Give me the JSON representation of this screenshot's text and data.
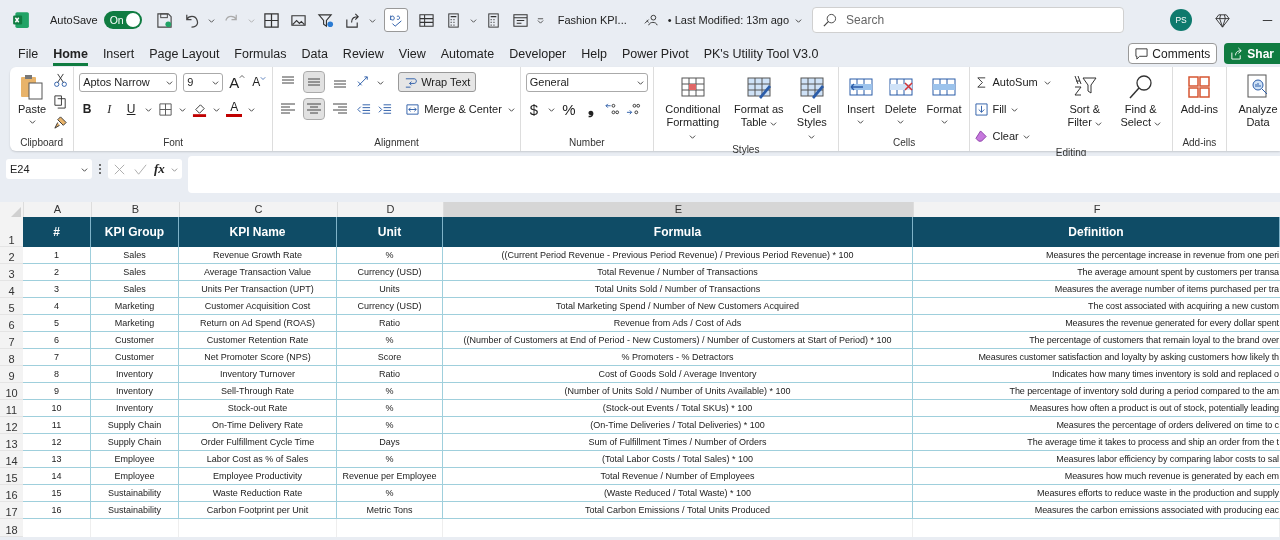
{
  "title_bar": {
    "autosave": {
      "label": "AutoSave",
      "on": true,
      "state_label": "On"
    },
    "file_name": "Fashion KPI...",
    "last_modified": "• Last Modified: 13m ago",
    "search": {
      "placeholder": "Search"
    },
    "avatar": "PS"
  },
  "menu_tabs": [
    {
      "label": "File",
      "selected": false
    },
    {
      "label": "Home",
      "selected": true
    },
    {
      "label": "Insert",
      "selected": false
    },
    {
      "label": "Page Layout",
      "selected": false
    },
    {
      "label": "Formulas",
      "selected": false
    },
    {
      "label": "Data",
      "selected": false
    },
    {
      "label": "Review",
      "selected": false
    },
    {
      "label": "View",
      "selected": false
    },
    {
      "label": "Automate",
      "selected": false
    },
    {
      "label": "Developer",
      "selected": false
    },
    {
      "label": "Help",
      "selected": false
    },
    {
      "label": "Power Pivot",
      "selected": false
    },
    {
      "label": "PK's Utility Tool V3.0",
      "selected": false
    }
  ],
  "comments_button": "Comments",
  "share_button": "Shar",
  "ribbon": {
    "clipboard": {
      "label": "Clipboard",
      "paste": "Paste"
    },
    "font": {
      "label": "Font",
      "family": "Aptos Narrow",
      "size": "9",
      "grow": "A",
      "shrink": "A",
      "bold": "B",
      "italic": "I",
      "underline": "U",
      "color_letter": "A"
    },
    "alignment": {
      "label": "Alignment",
      "vertical_align": [
        {
          "selected": false
        },
        {
          "selected": true
        },
        {
          "selected": false
        }
      ],
      "horizontal_align": [
        {
          "selected": false
        },
        {
          "selected": true
        },
        {
          "selected": false
        }
      ],
      "wrap_text": {
        "label": "Wrap Text",
        "selected": true
      },
      "merge": "Merge & Center"
    },
    "number": {
      "label": "Number",
      "format": "General",
      "currency": "$",
      "percent": "%",
      "comma": "❟"
    },
    "styles": {
      "label": "Styles",
      "items": [
        "Conditional Formatting",
        "Format as Table",
        "Cell Styles"
      ]
    },
    "cells": {
      "label": "Cells",
      "items": [
        "Insert",
        "Delete",
        "Format"
      ]
    },
    "editing": {
      "label": "Editing",
      "autosum": "AutoSum",
      "fill": "Fill",
      "clear": "Clear",
      "sort": "Sort & Filter",
      "find": "Find & Select"
    },
    "addins": {
      "label": "Add-ins",
      "button": "Add-ins"
    },
    "analyze": {
      "button": "Analyze Data"
    }
  },
  "formula_bar": {
    "name_box": "E24",
    "fx": "fx"
  },
  "sheet": {
    "columns": [
      {
        "letter": "A",
        "selected": false
      },
      {
        "letter": "B",
        "selected": false
      },
      {
        "letter": "C",
        "selected": false
      },
      {
        "letter": "D",
        "selected": false
      },
      {
        "letter": "E",
        "selected": true
      },
      {
        "letter": "F",
        "selected": false
      }
    ],
    "headers": [
      "#",
      "KPI Group",
      "KPI Name",
      "Unit",
      "Formula",
      "Definition"
    ],
    "rows": [
      [
        "1",
        "Sales",
        "Revenue Growth Rate",
        "%",
        "((Current Period Revenue - Previous Period Revenue) / Previous Period Revenue) * 100",
        "Measures the percentage increase in revenue from one peri"
      ],
      [
        "2",
        "Sales",
        "Average Transaction Value",
        "Currency (USD)",
        "Total Revenue / Number of Transactions",
        "The average amount spent by customers per transa"
      ],
      [
        "3",
        "Sales",
        "Units Per Transaction (UPT)",
        "Units",
        "Total Units Sold / Number of Transactions",
        "Measures the average number of items purchased per tra"
      ],
      [
        "4",
        "Marketing",
        "Customer Acquisition Cost",
        "Currency (USD)",
        "Total Marketing Spend / Number of New Customers Acquired",
        "The cost associated with acquiring a new custom"
      ],
      [
        "5",
        "Marketing",
        "Return on Ad Spend (ROAS)",
        "Ratio",
        "Revenue from Ads / Cost of Ads",
        "Measures the revenue generated for every dollar spent"
      ],
      [
        "6",
        "Customer",
        "Customer Retention Rate",
        "%",
        "((Number of Customers at End of Period - New Customers) / Number of Customers at Start of Period) * 100",
        "The percentage of customers that remain loyal to the brand over"
      ],
      [
        "7",
        "Customer",
        "Net Promoter Score (NPS)",
        "Score",
        "% Promoters - % Detractors",
        "Measures customer satisfaction and loyalty by asking customers how likely th"
      ],
      [
        "8",
        "Inventory",
        "Inventory Turnover",
        "Ratio",
        "Cost of Goods Sold / Average Inventory",
        "Indicates how many times inventory is sold and replaced o"
      ],
      [
        "9",
        "Inventory",
        "Sell-Through Rate",
        "%",
        "(Number of Units Sold / Number of Units Available) * 100",
        "The percentage of inventory sold during a period compared to the am"
      ],
      [
        "10",
        "Inventory",
        "Stock-out Rate",
        "%",
        "(Stock-out Events / Total SKUs) * 100",
        "Measures how often a product is out of stock, potentially leading"
      ],
      [
        "11",
        "Supply Chain",
        "On-Time Delivery Rate",
        "%",
        "(On-Time Deliveries / Total Deliveries) * 100",
        "Measures the percentage of orders delivered on time to c"
      ],
      [
        "12",
        "Supply Chain",
        "Order Fulfillment Cycle Time",
        "Days",
        "Sum of Fulfillment Times / Number of Orders",
        "The average time it takes to process and ship an order from the t"
      ],
      [
        "13",
        "Employee",
        "Labor Cost as % of Sales",
        "%",
        "(Total Labor Costs / Total Sales) * 100",
        "Measures labor efficiency by comparing labor costs to sal"
      ],
      [
        "14",
        "Employee",
        "Employee Productivity",
        "Revenue per Employee",
        "Total Revenue / Number of Employees",
        "Measures how much revenue is generated by each em"
      ],
      [
        "15",
        "Sustainability",
        "Waste Reduction Rate",
        "%",
        "(Waste Reduced / Total Waste) * 100",
        "Measures efforts to reduce waste in the production and supply"
      ],
      [
        "16",
        "Sustainability",
        "Carbon Footprint per Unit",
        "Metric Tons",
        "Total Carbon Emissions / Total Units Produced",
        "Measures the carbon emissions associated with producing eac"
      ]
    ],
    "row_numbers": [
      "1",
      "2",
      "3",
      "4",
      "5",
      "6",
      "7",
      "8",
      "9",
      "10",
      "11",
      "12",
      "13",
      "14",
      "15",
      "16",
      "17",
      "18"
    ]
  }
}
